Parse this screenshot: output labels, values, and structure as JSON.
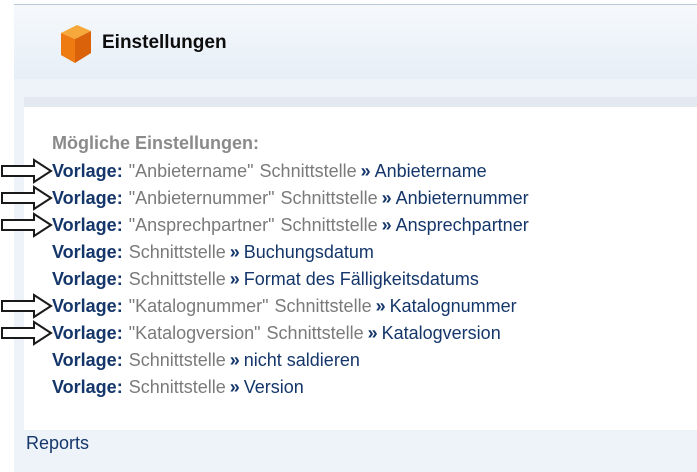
{
  "header": {
    "title": "Einstellungen",
    "icon": "cube-icon"
  },
  "section": {
    "title": "Mögliche Einstellungen:"
  },
  "rows": [
    {
      "label": "Vorlage:",
      "template": "\"Anbietername\"",
      "iface": "Schnittstelle",
      "sep": "»",
      "setting": "Anbietername",
      "marked": true
    },
    {
      "label": "Vorlage:",
      "template": "\"Anbieternummer\"",
      "iface": "Schnittstelle",
      "sep": "»",
      "setting": "Anbieternummer",
      "marked": true
    },
    {
      "label": "Vorlage:",
      "template": "\"Ansprechpartner\"",
      "iface": "Schnittstelle",
      "sep": "»",
      "setting": "Ansprechpartner",
      "marked": true
    },
    {
      "label": "Vorlage:",
      "template": "",
      "iface": "Schnittstelle",
      "sep": "»",
      "setting": "Buchungsdatum",
      "marked": false
    },
    {
      "label": "Vorlage:",
      "template": "",
      "iface": "Schnittstelle",
      "sep": "»",
      "setting": "Format des Fälligkeitsdatums",
      "marked": false
    },
    {
      "label": "Vorlage:",
      "template": "\"Katalognummer\"",
      "iface": "Schnittstelle",
      "sep": "»",
      "setting": "Katalognummer",
      "marked": true
    },
    {
      "label": "Vorlage:",
      "template": "\"Katalogversion\"",
      "iface": "Schnittstelle",
      "sep": "»",
      "setting": "Katalogversion",
      "marked": true
    },
    {
      "label": "Vorlage:",
      "template": "",
      "iface": "Schnittstelle",
      "sep": "»",
      "setting": "nicht saldieren",
      "marked": false
    },
    {
      "label": "Vorlage:",
      "template": "",
      "iface": "Schnittstelle",
      "sep": "»",
      "setting": "Version",
      "marked": false
    }
  ],
  "footer": {
    "reports_label": "Reports"
  },
  "colors": {
    "link": "#14366a",
    "muted": "#7a7a7a",
    "header_bg": "#e6eef7",
    "cube": "#f08a1c"
  }
}
